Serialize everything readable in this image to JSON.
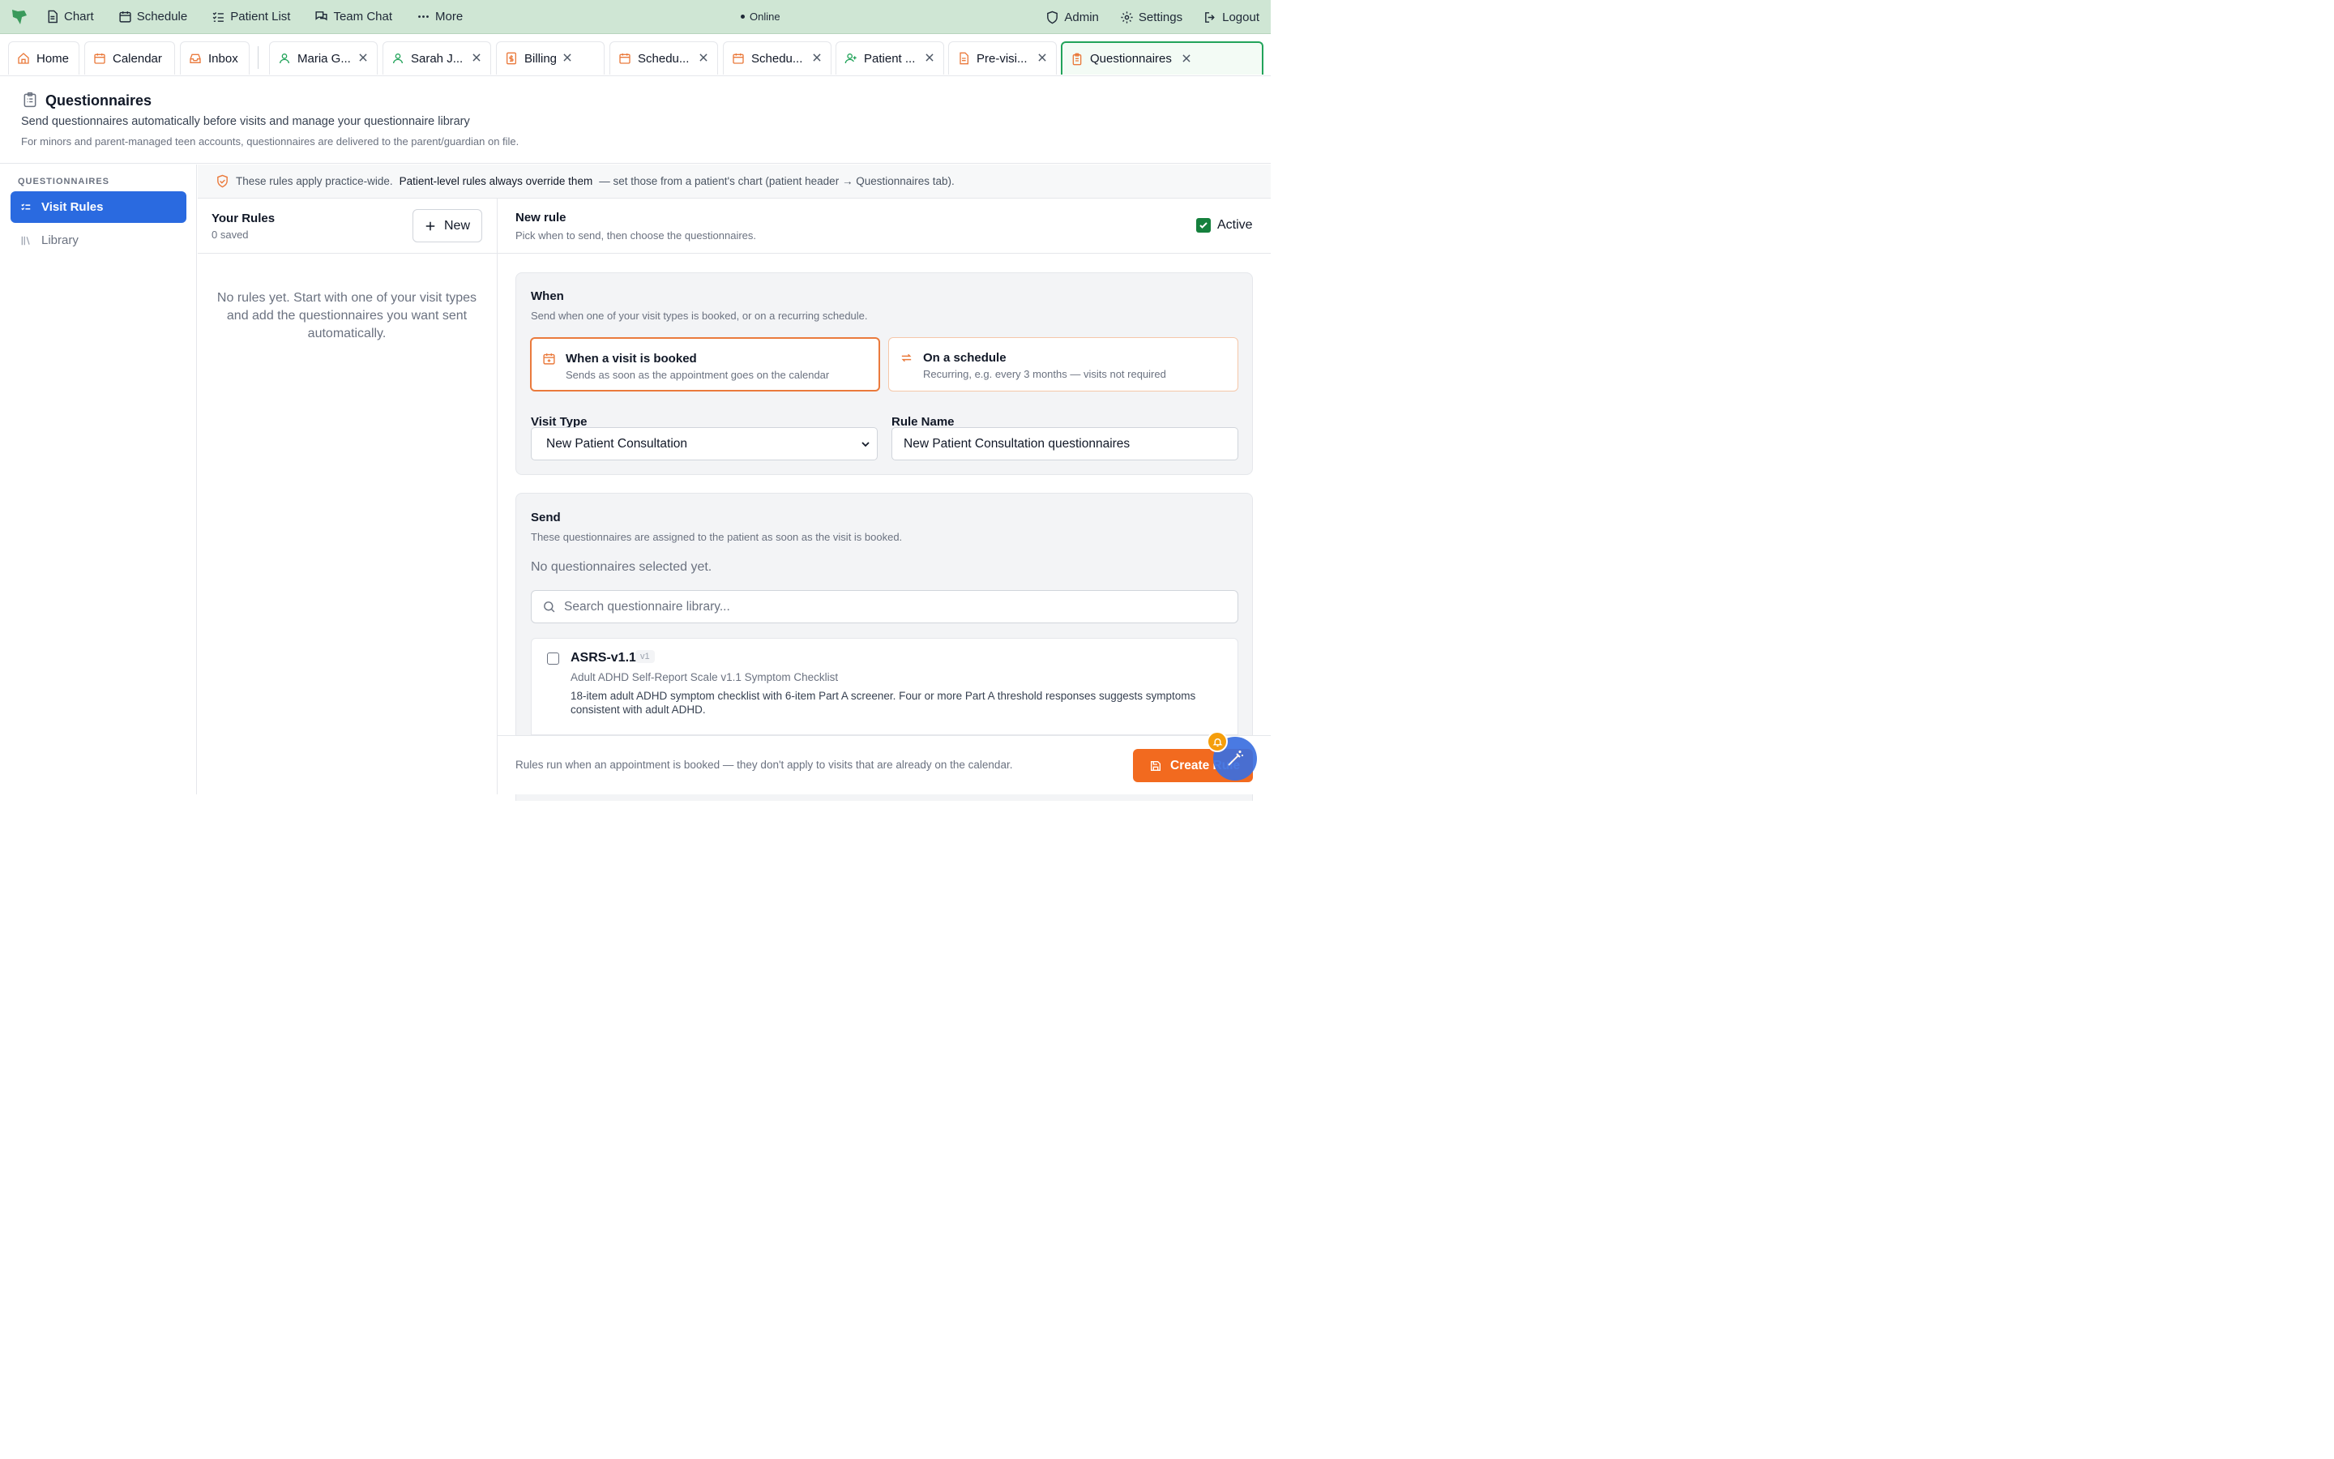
{
  "topbar": {
    "nav": [
      {
        "label": "Chart",
        "icon": "document-icon"
      },
      {
        "label": "Schedule",
        "icon": "calendar-icon"
      },
      {
        "label": "Patient List",
        "icon": "list-check-icon"
      },
      {
        "label": "Team Chat",
        "icon": "chat-icon"
      },
      {
        "label": "More",
        "icon": "more-icon"
      }
    ],
    "status": "Online",
    "right": [
      {
        "label": "Admin",
        "icon": "shield-icon"
      },
      {
        "label": "Settings",
        "icon": "gear-icon"
      },
      {
        "label": "Logout",
        "icon": "logout-icon"
      }
    ]
  },
  "tabs": [
    {
      "label": "Home",
      "icon": "home-icon"
    },
    {
      "label": "Calendar",
      "icon": "calendar-icon"
    },
    {
      "label": "Inbox",
      "icon": "inbox-icon"
    },
    {
      "label": "Maria G...",
      "icon": "user-icon"
    },
    {
      "label": "Sarah J...",
      "icon": "user-icon"
    },
    {
      "label": "Billing",
      "icon": "billing-icon"
    },
    {
      "label": "Schedu...",
      "icon": "calendar-icon"
    },
    {
      "label": "Schedu...",
      "icon": "calendar-icon"
    },
    {
      "label": "Patient ...",
      "icon": "user-plus-icon"
    },
    {
      "label": "Pre-visi...",
      "icon": "document-icon"
    },
    {
      "label": "Questionnaires",
      "icon": "clipboard-icon"
    }
  ],
  "page": {
    "title": "Questionnaires",
    "subtitle": "Send questionnaires automatically before visits and manage your questionnaire library",
    "note": "For minors and parent-managed teen accounts, questionnaires are delivered to the parent/guardian on file."
  },
  "sidebar": {
    "heading": "QUESTIONNAIRES",
    "items": [
      {
        "label": "Visit Rules",
        "active": true
      },
      {
        "label": "Library",
        "active": false
      }
    ]
  },
  "banner": {
    "part1": "These rules apply practice-wide.",
    "bold": "Patient-level rules always override them",
    "part2": "— set those from a patient's chart (patient header → Questionnaires tab)."
  },
  "rules": {
    "title": "Your Rules",
    "count": "0 saved",
    "new_label": "New",
    "empty": "No rules yet. Start with one of your visit types and add the questionnaires you want sent automatically."
  },
  "editor": {
    "title": "New rule",
    "subtitle": "Pick when to send, then choose the questionnaires.",
    "active_label": "Active",
    "active_checked": true,
    "when": {
      "title": "When",
      "subtitle": "Send when one of your visit types is booked, or on a recurring schedule.",
      "options": [
        {
          "title": "When a visit is booked",
          "desc": "Sends as soon as the appointment goes on the calendar",
          "selected": true
        },
        {
          "title": "On a schedule",
          "desc": "Recurring, e.g. every 3 months — visits not required",
          "selected": false
        }
      ],
      "visit_type_label": "Visit Type",
      "visit_type_value": "New Patient Consultation",
      "rule_name_label": "Rule Name",
      "rule_name_value": "New Patient Consultation questionnaires"
    },
    "send": {
      "title": "Send",
      "subtitle": "These questionnaires are assigned to the patient as soon as the visit is booked.",
      "empty": "No questionnaires selected yet.",
      "search_placeholder": "Search questionnaire library...",
      "items": [
        {
          "name": "ASRS-v1.1",
          "version": "v1",
          "full_name": "Adult ADHD Self-Report Scale v1.1 Symptom Checklist",
          "description": "18-item adult ADHD symptom checklist with 6-item Part A screener. Four or more Part A threshold responses suggests symptoms consistent with adult ADHD."
        }
      ]
    },
    "footer_note": "Rules run when an appointment is booked — they don't apply to visits that are already on the calendar.",
    "create_label": "Create Rule"
  },
  "colors": {
    "topbar_bg": "#cfe6d4",
    "accent_orange": "#f26a1f",
    "accent_blue": "#2a6ae0",
    "accent_green": "#22a35a"
  }
}
